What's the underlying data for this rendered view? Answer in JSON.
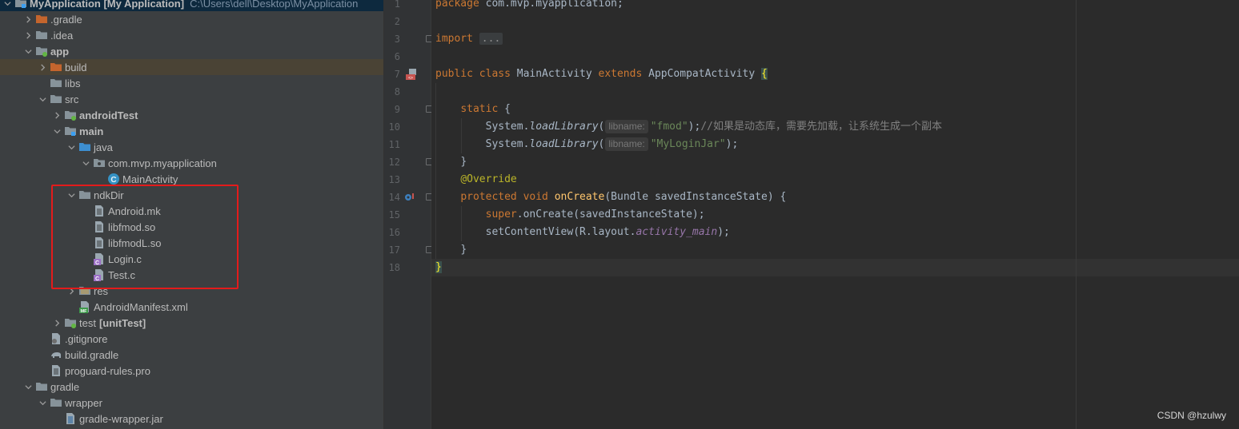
{
  "project_tree": {
    "root": {
      "label": "MyApplication [My Application]",
      "path": "C:\\Users\\dell\\Desktop\\MyApplication"
    },
    "items": [
      {
        "label": ".gradle"
      },
      {
        "label": ".idea"
      },
      {
        "label": "app"
      },
      {
        "label": "build"
      },
      {
        "label": "libs"
      },
      {
        "label": "src"
      },
      {
        "label": "androidTest"
      },
      {
        "label": "main"
      },
      {
        "label": "java"
      },
      {
        "label": "com.mvp.myapplication"
      },
      {
        "label": "MainActivity"
      },
      {
        "label": "ndkDir"
      },
      {
        "label": "Android.mk"
      },
      {
        "label": "libfmod.so"
      },
      {
        "label": "libfmodL.so"
      },
      {
        "label": "Login.c"
      },
      {
        "label": "Test.c"
      },
      {
        "label": "res"
      },
      {
        "label": "AndroidManifest.xml"
      },
      {
        "label": "test",
        "suffix": "[unitTest]"
      },
      {
        "label": ".gitignore"
      },
      {
        "label": "build.gradle"
      },
      {
        "label": "proguard-rules.pro"
      },
      {
        "label": "gradle"
      },
      {
        "label": "wrapper"
      },
      {
        "label": "gradle-wrapper.jar"
      }
    ]
  },
  "editor": {
    "line_numbers": [
      "1",
      "2",
      "3",
      "6",
      "7",
      "8",
      "9",
      "10",
      "11",
      "12",
      "13",
      "14",
      "15",
      "16",
      "17",
      "18"
    ],
    "code": {
      "l1_kw": "package",
      "l1_rest": " com.mvp.myapplication;",
      "l3_kw": "import",
      "l3_fold": "...",
      "l7_kw1": "public class",
      "l7_name": " MainActivity ",
      "l7_kw2": "extends",
      "l7_super": " AppCompatActivity ",
      "l7_brace": "{",
      "l9_kw": "static",
      "l9_brace": " {",
      "l10_call": "System.",
      "l10_method": "loadLibrary",
      "l10_paren": "(",
      "l10_hint": "libname:",
      "l10_str": "\"fmod\"",
      "l10_end": ");",
      "l10_comment": "//如果是动态库，需要先加载，让系统生成一个副本",
      "l11_call": "System.",
      "l11_method": "loadLibrary",
      "l11_paren": "(",
      "l11_hint": "libname:",
      "l11_str": "\"MyLoginJar\"",
      "l11_end": ");",
      "l12": "}",
      "l13": "@Override",
      "l14_kw": "protected void",
      "l14_fn": " onCreate",
      "l14_rest": "(Bundle savedInstanceState) {",
      "l15_kw": "super",
      "l15_rest": ".onCreate(savedInstanceState);",
      "l16_call": "setContentView(R.layout.",
      "l16_field": "activity_main",
      "l16_end": ");",
      "l17": "}",
      "l18": "}"
    }
  },
  "watermark": "CSDN @hzulwy",
  "colors": {
    "highlight_box": "#e31b1b",
    "selected_row": "#4a4335",
    "root_row": "#0d293e"
  }
}
